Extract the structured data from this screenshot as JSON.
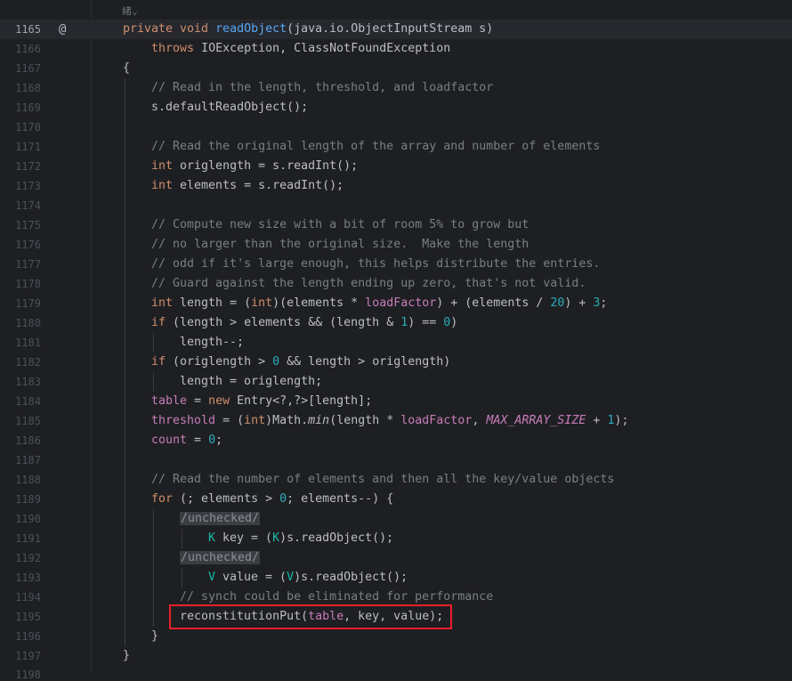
{
  "editor": {
    "hint_text": "緒⌄",
    "override_icon": "@",
    "lines": [
      {
        "n": "1165",
        "current": true,
        "indent": 0,
        "parts": [
          [
            "kw",
            "private void "
          ],
          [
            "fn",
            "readObject"
          ],
          [
            "",
            "(java.io.ObjectInputStream s)"
          ]
        ]
      },
      {
        "n": "1166",
        "indent": 0,
        "parts": [
          [
            "",
            "    "
          ],
          [
            "kw",
            "throws "
          ],
          [
            "",
            "IOException, ClassNotFoundException"
          ]
        ]
      },
      {
        "n": "1167",
        "indent": 0,
        "parts": [
          [
            "",
            "{"
          ]
        ]
      },
      {
        "n": "1168",
        "indent": 1,
        "parts": [
          [
            "cm",
            "// Read in the length, threshold, and loadfactor"
          ]
        ]
      },
      {
        "n": "1169",
        "indent": 1,
        "parts": [
          [
            "",
            "s.defaultReadObject();"
          ]
        ]
      },
      {
        "n": "1170",
        "indent": 1,
        "parts": []
      },
      {
        "n": "1171",
        "indent": 1,
        "parts": [
          [
            "cm",
            "// Read the original length of the array and number of elements"
          ]
        ]
      },
      {
        "n": "1172",
        "indent": 1,
        "parts": [
          [
            "kw",
            "int "
          ],
          [
            "",
            "origlength = s.readInt();"
          ]
        ]
      },
      {
        "n": "1173",
        "indent": 1,
        "parts": [
          [
            "kw",
            "int "
          ],
          [
            "",
            "elements = s.readInt();"
          ]
        ]
      },
      {
        "n": "1174",
        "indent": 1,
        "parts": []
      },
      {
        "n": "1175",
        "indent": 1,
        "parts": [
          [
            "cm",
            "// Compute new size with a bit of room 5% to grow but"
          ]
        ]
      },
      {
        "n": "1176",
        "indent": 1,
        "parts": [
          [
            "cm",
            "// no larger than the original size.  Make the length"
          ]
        ]
      },
      {
        "n": "1177",
        "indent": 1,
        "parts": [
          [
            "cm",
            "// odd if it's large enough, this helps distribute the entries."
          ]
        ]
      },
      {
        "n": "1178",
        "indent": 1,
        "parts": [
          [
            "cm",
            "// Guard against the length ending up zero, that's not valid."
          ]
        ]
      },
      {
        "n": "1179",
        "indent": 1,
        "parts": [
          [
            "kw",
            "int "
          ],
          [
            "",
            "length = ("
          ],
          [
            "kw",
            "int"
          ],
          [
            "",
            ")(elements * "
          ],
          [
            "field",
            "loadFactor"
          ],
          [
            "",
            ") + (elements / "
          ],
          [
            "num",
            "20"
          ],
          [
            "",
            ") + "
          ],
          [
            "num",
            "3"
          ],
          [
            "",
            ";"
          ]
        ]
      },
      {
        "n": "1180",
        "indent": 1,
        "parts": [
          [
            "kw",
            "if "
          ],
          [
            "",
            "(length > elements && (length & "
          ],
          [
            "num",
            "1"
          ],
          [
            "",
            ") == "
          ],
          [
            "num",
            "0"
          ],
          [
            "",
            ")"
          ]
        ]
      },
      {
        "n": "1181",
        "indent": 2,
        "parts": [
          [
            "",
            "length--;"
          ]
        ]
      },
      {
        "n": "1182",
        "indent": 1,
        "parts": [
          [
            "kw",
            "if "
          ],
          [
            "",
            "(origlength > "
          ],
          [
            "num",
            "0"
          ],
          [
            "",
            " && length > origlength)"
          ]
        ]
      },
      {
        "n": "1183",
        "indent": 2,
        "parts": [
          [
            "",
            "length = origlength;"
          ]
        ]
      },
      {
        "n": "1184",
        "indent": 1,
        "parts": [
          [
            "field",
            "table"
          ],
          [
            "",
            " = "
          ],
          [
            "kw",
            "new "
          ],
          [
            "",
            "Entry<?,?>[length];"
          ]
        ]
      },
      {
        "n": "1185",
        "indent": 1,
        "parts": [
          [
            "field",
            "threshold"
          ],
          [
            "",
            " = ("
          ],
          [
            "kw",
            "int"
          ],
          [
            "",
            ")Math."
          ],
          [
            "static-fn",
            "min"
          ],
          [
            "",
            "(length * "
          ],
          [
            "field",
            "loadFactor"
          ],
          [
            "",
            ", "
          ],
          [
            "const",
            "MAX_ARRAY_SIZE"
          ],
          [
            "",
            " + "
          ],
          [
            "num",
            "1"
          ],
          [
            "",
            ");"
          ]
        ]
      },
      {
        "n": "1186",
        "indent": 1,
        "parts": [
          [
            "field",
            "count"
          ],
          [
            "",
            " = "
          ],
          [
            "num",
            "0"
          ],
          [
            "",
            ";"
          ]
        ]
      },
      {
        "n": "1187",
        "indent": 1,
        "parts": []
      },
      {
        "n": "1188",
        "indent": 1,
        "parts": [
          [
            "cm",
            "// Read the number of elements and then all the key/value objects"
          ]
        ]
      },
      {
        "n": "1189",
        "indent": 1,
        "parts": [
          [
            "kw",
            "for "
          ],
          [
            "",
            "(; elements > "
          ],
          [
            "num",
            "0"
          ],
          [
            "",
            "; elements--) {"
          ]
        ]
      },
      {
        "n": "1190",
        "indent": 2,
        "parts": [
          [
            "unchecked",
            "/unchecked/"
          ]
        ]
      },
      {
        "n": "1191",
        "indent": 3,
        "parts": [
          [
            "tp",
            "K "
          ],
          [
            "",
            "key = ("
          ],
          [
            "tp",
            "K"
          ],
          [
            "",
            ")s.readObject();"
          ]
        ]
      },
      {
        "n": "1192",
        "indent": 2,
        "parts": [
          [
            "unchecked",
            "/unchecked/"
          ]
        ]
      },
      {
        "n": "1193",
        "indent": 3,
        "parts": [
          [
            "tp",
            "V "
          ],
          [
            "",
            "value = ("
          ],
          [
            "tp",
            "V"
          ],
          [
            "",
            ")s.readObject();"
          ]
        ]
      },
      {
        "n": "1194",
        "indent": 2,
        "parts": [
          [
            "cm",
            "// synch could be eliminated for performance"
          ]
        ]
      },
      {
        "n": "1195",
        "indent": 2,
        "parts": [
          [
            "",
            "reconstitutionPut("
          ],
          [
            "field",
            "table"
          ],
          [
            "",
            ", key, value);"
          ]
        ]
      },
      {
        "n": "1196",
        "indent": 1,
        "parts": [
          [
            "",
            "}"
          ]
        ]
      },
      {
        "n": "1197",
        "indent": 0,
        "parts": [
          [
            "",
            "}"
          ]
        ]
      }
    ],
    "next_line_partial": "1198"
  },
  "colors": {
    "background": "#1e1f22",
    "keyword": "#cf8e6d",
    "method": "#56a8f5",
    "number": "#2aacb8",
    "comment": "#7a7e85",
    "field": "#c77dbb",
    "highlight_box": "#e8202a"
  }
}
